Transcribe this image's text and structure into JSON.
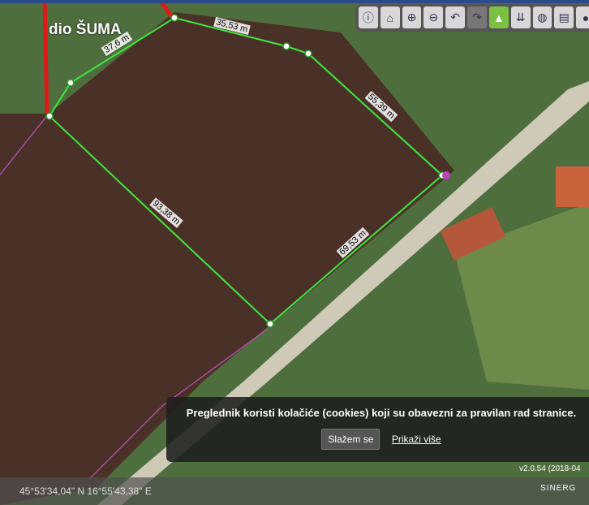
{
  "map": {
    "annotation": "dio ŠUMA",
    "segments": [
      "37,6 m",
      "35,53 m",
      "55,39 m",
      "69,53 m",
      "93,38 m"
    ]
  },
  "toolbar": {
    "icons": [
      "info-pointer-icon",
      "home-icon",
      "zoom-in-icon",
      "zoom-out-icon",
      "previous-extent-icon",
      "next-extent-icon",
      "measure-area-icon",
      "measure-distance-icon",
      "globe-icon",
      "print-icon",
      "more-icon"
    ],
    "active": "measure-area-icon"
  },
  "cookie": {
    "message": "Preglednik koristi kolačiće (cookies) koji su obavezni za pravilan rad stranice.",
    "agree": "Slažem se",
    "more": "Prikaži više"
  },
  "footer": {
    "version": "v2.0.54 (2018-04",
    "coordinates": "45°53'34,04\" N 16°55'43,38\" E",
    "logo": "SINERG"
  }
}
